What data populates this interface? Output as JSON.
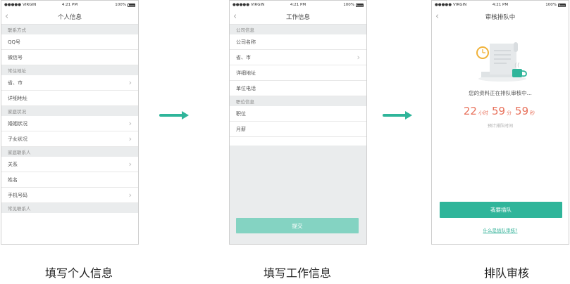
{
  "status_bar": {
    "carrier": "VIRGIN",
    "time": "4:21 PM",
    "battery": "100%"
  },
  "screen1": {
    "title": "个人信息",
    "groups": [
      {
        "header": "联系方式",
        "rows": [
          {
            "label": "QQ号",
            "arrow": false
          },
          {
            "label": "微信号",
            "arrow": false
          }
        ]
      },
      {
        "header": "常住地址",
        "rows": [
          {
            "label": "省、市",
            "arrow": true
          },
          {
            "label": "详细地址",
            "arrow": false
          }
        ]
      },
      {
        "header": "家庭状况",
        "rows": [
          {
            "label": "婚姻状况",
            "arrow": true
          },
          {
            "label": "子女状况",
            "arrow": true
          }
        ]
      },
      {
        "header": "家庭联系人",
        "rows": [
          {
            "label": "关系",
            "arrow": true
          },
          {
            "label": "姓名",
            "arrow": false
          },
          {
            "label": "手机号码",
            "arrow": true
          }
        ]
      },
      {
        "header": "常见联系人",
        "rows": []
      }
    ]
  },
  "screen2": {
    "title": "工作信息",
    "groups": [
      {
        "header": "公司信息",
        "rows": [
          {
            "label": "公司名称",
            "arrow": false
          },
          {
            "label": "省、市",
            "arrow": true
          },
          {
            "label": "详细地址",
            "arrow": false
          },
          {
            "label": "单位电话",
            "arrow": false
          }
        ]
      },
      {
        "header": "职位信息",
        "rows": [
          {
            "label": "职位",
            "arrow": false
          },
          {
            "label": "月薪",
            "arrow": false
          }
        ]
      }
    ],
    "submit_label": "提交"
  },
  "screen3": {
    "title": "审核排队中",
    "status_text": "您的资料正在排队审核中...",
    "countdown": {
      "hours": "22",
      "hours_unit": "小时",
      "minutes": "59",
      "minutes_unit": "分",
      "seconds": "59",
      "seconds_unit": "秒"
    },
    "estimate_label": "预计排队时间",
    "queue_button": "我要插队",
    "link_text": "什么是插队审核?"
  },
  "captions": {
    "c1": "填写个人信息",
    "c2": "填写工作信息",
    "c3": "排队审核"
  },
  "colors": {
    "accent": "#2fb59a",
    "accent_light": "#84d3c2",
    "countdown": "#e8705a",
    "section_bg": "#eaeced"
  }
}
